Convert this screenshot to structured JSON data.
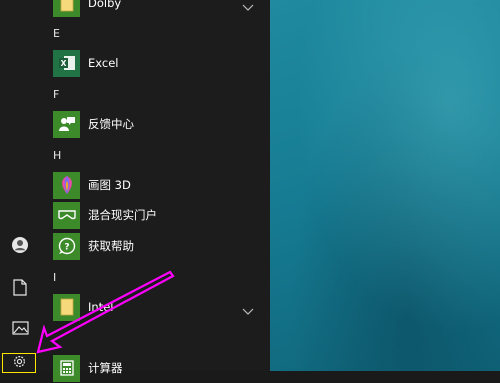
{
  "colors": {
    "accent": "#ff00ff",
    "tile_green": "#3d8a2a",
    "menu_bg": "#1c1c1c",
    "desktop": "#167c93"
  },
  "rail": [
    {
      "name": "user-icon"
    },
    {
      "name": "documents-icon"
    },
    {
      "name": "pictures-icon"
    },
    {
      "name": "settings-icon"
    }
  ],
  "apps": {
    "dolby": {
      "label": "Dolby",
      "icon": "folder-icon",
      "expandable": true
    },
    "letter_e": "E",
    "excel": {
      "label": "Excel",
      "icon": "excel-icon"
    },
    "letter_f": "F",
    "feedback": {
      "label": "反馈中心",
      "icon": "feedback-hub-icon"
    },
    "letter_h": "H",
    "paint3d": {
      "label": "画图 3D",
      "icon": "paint-3d-icon"
    },
    "mixed_reality": {
      "label": "混合现实门户",
      "icon": "mixed-reality-icon"
    },
    "get_help": {
      "label": "获取帮助",
      "icon": "get-help-icon"
    },
    "letter_i": "I",
    "intel": {
      "label": "Intel",
      "icon": "folder-icon",
      "expandable": true
    },
    "calculator": {
      "label": "计算器",
      "icon": "calculator-icon"
    }
  }
}
